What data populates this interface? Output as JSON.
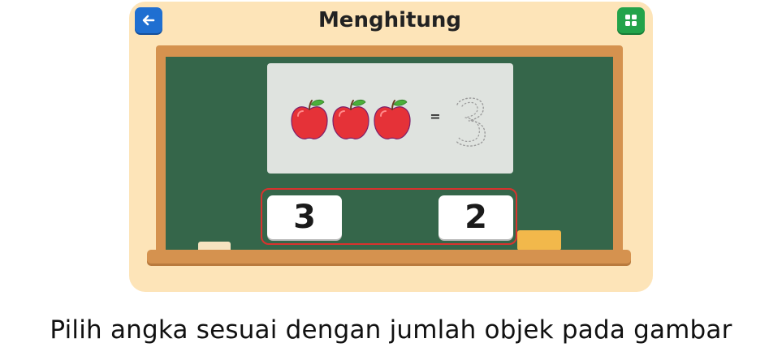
{
  "header": {
    "title": "Menghitung",
    "back_icon": "arrow-left-icon",
    "menu_icon": "grid-icon",
    "back_color": "#1f6fd1",
    "menu_color": "#23a34a"
  },
  "question": {
    "object_icon": "apple-icon",
    "object_count": 3,
    "operator": "=",
    "traced_answer": "3"
  },
  "choices": [
    {
      "label": "3"
    },
    {
      "label": "2"
    }
  ],
  "instruction": "Pilih angka sesuai dengan jumlah objek pada gambar",
  "colors": {
    "frame": "#fde4b8",
    "board": "#35664a",
    "wood": "#d5924f",
    "apple": "#e53238",
    "highlight": "#d9322e"
  }
}
